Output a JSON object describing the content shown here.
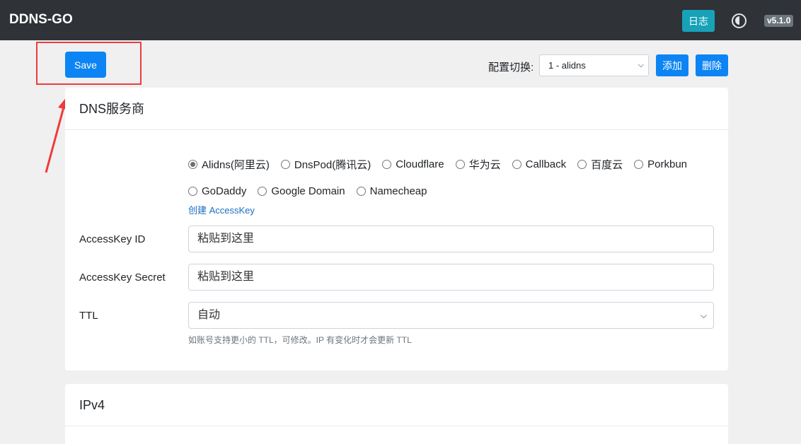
{
  "app": {
    "brand": "DDNS-GO",
    "log_button": "日志",
    "version": "v5.1.0"
  },
  "toolbar": {
    "save_label": "Save",
    "config_label": "配置切换:",
    "config_selected": "1 - alidns",
    "add_label": "添加",
    "delete_label": "删除"
  },
  "dns_card": {
    "title": "DNS服务商",
    "providers_row1": [
      "Alidns(阿里云)",
      "DnsPod(腾讯云)",
      "Cloudflare",
      "华为云",
      "Callback",
      "百度云",
      "Porkbun"
    ],
    "providers_row2": [
      "GoDaddy",
      "Google Domain",
      "Namecheap"
    ],
    "selected_provider": "Alidns(阿里云)",
    "create_link": "创建 AccessKey",
    "access_key_id_label": "AccessKey ID",
    "access_key_id_placeholder": "粘贴到这里",
    "access_key_secret_label": "AccessKey Secret",
    "access_key_secret_placeholder": "粘贴到这里",
    "ttl_label": "TTL",
    "ttl_value": "自动",
    "ttl_help": "如账号支持更小的 TTL，可修改。IP 有变化时才会更新 TTL"
  },
  "ipv4_card": {
    "title": "IPv4"
  },
  "annotation": {
    "color": "#ee3b3b"
  }
}
